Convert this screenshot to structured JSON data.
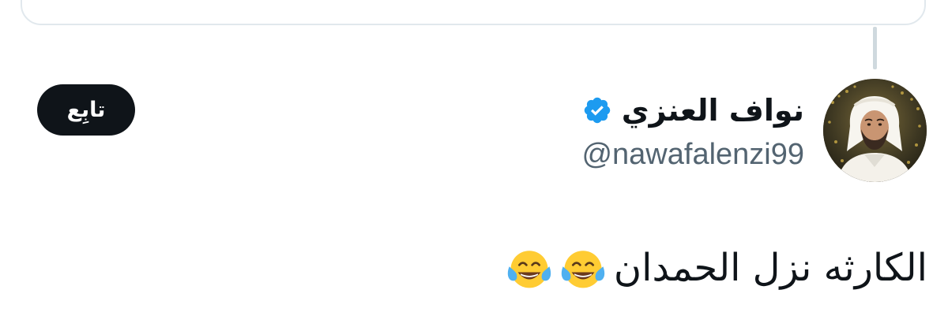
{
  "tweet": {
    "author": {
      "display_name": "نواف العنزي",
      "handle": "@nawafalenzi99",
      "verified": true,
      "verified_color": "#1d9bf0",
      "avatar_icon": "profile-photo"
    },
    "follow_label": "تابِع",
    "text": "الكارثه نزل الحمدان",
    "emojis": [
      "face-with-tears-of-joy-icon",
      "face-with-tears-of-joy-icon"
    ]
  },
  "colors": {
    "text_primary": "#0f1419",
    "text_secondary": "#536471",
    "button_bg": "#0f1419",
    "button_text": "#ffffff",
    "border": "#e1e8ed",
    "thread_line": "#cfd9de"
  }
}
